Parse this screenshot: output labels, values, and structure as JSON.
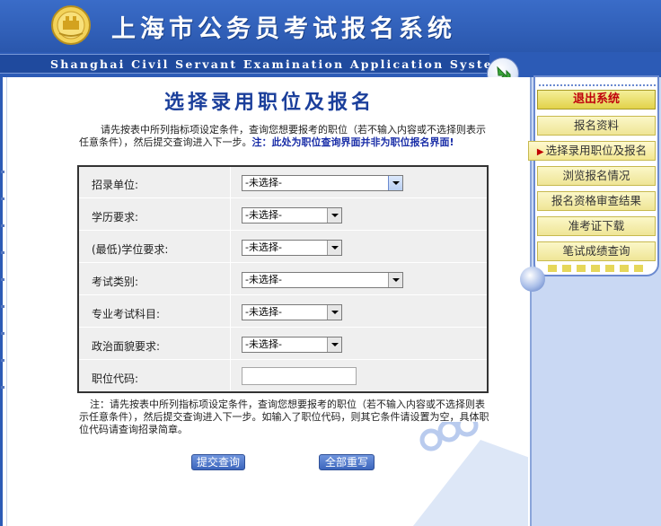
{
  "header": {
    "site_title": "上海市公务员考试报名系统",
    "banner_text": "Shanghai Civil Servant Examination Application System"
  },
  "sidebar": {
    "logout_label": "退出系统",
    "items": [
      {
        "label": "报名资料",
        "active": false
      },
      {
        "label": "选择录用职位及报名",
        "active": true
      },
      {
        "label": "浏览报名情况",
        "active": false
      },
      {
        "label": "报名资格审查结果",
        "active": false
      },
      {
        "label": "准考证下载",
        "active": false
      },
      {
        "label": "笔试成绩查询",
        "active": false
      }
    ]
  },
  "main": {
    "title": "选择录用职位及报名",
    "intro_text": "请先按表中所列指标项设定条件，查询您想要报考的职位（若不输入内容或不选择则表示任意条件），然后提交查询进入下一步。",
    "intro_warning": "注：此处为职位查询界面并非为职位报名界面!",
    "fields": [
      {
        "label": "招录单位:",
        "value": "-未选择-"
      },
      {
        "label": "学历要求:",
        "value": "-未选择-"
      },
      {
        "label": "(最低)学位要求:",
        "value": "-未选择-"
      },
      {
        "label": "考试类别:",
        "value": "-未选择-"
      },
      {
        "label": "专业考试科目:",
        "value": "-未选择-"
      },
      {
        "label": "政治面貌要求:",
        "value": "-未选择-"
      }
    ],
    "code_field": {
      "label": "职位代码:",
      "value": ""
    },
    "note_text": "注：请先按表中所列指标项设定条件，查询您想要报考的职位（若不输入内容或不选择则表示任意条件），然后提交查询进入下一步。如输入了职位代码，则其它条件请设置为空，具体职位代码请查询招录简章。",
    "submit_label": "提交查询",
    "reset_label": "全部重写"
  },
  "colors": {
    "header_blue": "#2c5bb6",
    "title_blue": "#1b3f9b",
    "warning_blue": "#1b2fa8",
    "logout_red": "#c0000c",
    "menu_yellow": "#efe596"
  },
  "icons": {
    "emblem": "shanghai-emblem-icon",
    "arrow": "green-arrow-icon"
  }
}
